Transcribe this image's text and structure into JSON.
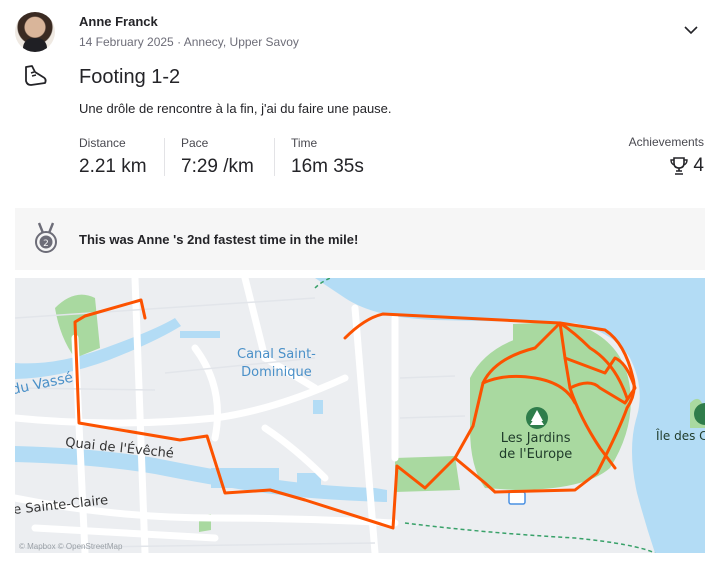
{
  "athlete": {
    "name": "Anne Franck",
    "meta": "14 February 2025 · Annecy, Upper Savoy"
  },
  "activity": {
    "icon": "running-shoe-icon",
    "title": "Footing 1-2",
    "description": "Une drôle de rencontre à la fin, j'ai du faire une pause."
  },
  "stats": [
    {
      "label": "Distance",
      "value": "2.21 km"
    },
    {
      "label": "Pace",
      "value": "7:29 /km"
    },
    {
      "label": "Time",
      "value": "16m 35s"
    }
  ],
  "achievements": {
    "label": "Achievements",
    "value": "4",
    "icon": "trophy-icon"
  },
  "banner": {
    "text": "This was Anne 's 2nd fastest time in the mile!",
    "icon": "medal-icon"
  },
  "map": {
    "labels": {
      "canal": "Canal Saint-\nDominique",
      "canal_line1": "Canal Saint-",
      "canal_line2": "Dominique",
      "quai_eveche": "Quai de l'Évêché",
      "vasse": "du Vassé",
      "sainte_claire": "e Sainte-Claire",
      "jardins_line1": "Les Jardins",
      "jardins_line2": "de l'Europe",
      "ile": "Île des C",
      "credit": "© Mapbox © OpenStreetMap"
    },
    "colors": {
      "route": "#fc5200",
      "water": "#b3dcf5",
      "park": "#a9d9a0",
      "road": "#ffffff"
    }
  }
}
